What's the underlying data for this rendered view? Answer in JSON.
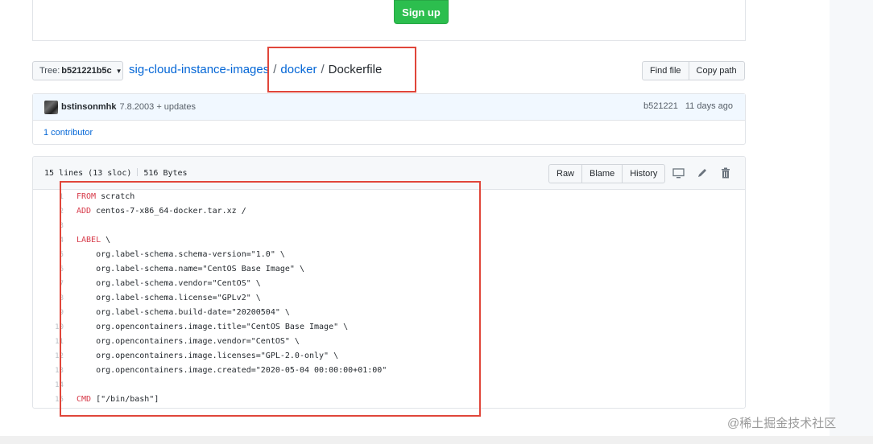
{
  "signup": {
    "label": "Sign up"
  },
  "tree": {
    "prefix": "Tree:",
    "value": "b521221b5c"
  },
  "breadcrumb": {
    "repo": "sig-cloud-instance-images",
    "folder": "docker",
    "file": "Dockerfile",
    "separator": "/"
  },
  "file_actions": {
    "find_file": "Find file",
    "copy_path": "Copy path"
  },
  "commit": {
    "author": "bstinsonmhk",
    "message": "7.8.2003 + updates",
    "sha": "b521221",
    "time": "11 days ago",
    "contributors": "1 contributor"
  },
  "file": {
    "lines_info": "15 lines (13 sloc)",
    "size": "516 Bytes",
    "buttons": {
      "raw": "Raw",
      "blame": "Blame",
      "history": "History"
    },
    "icons": [
      "desktop-icon",
      "pencil-icon",
      "trash-icon"
    ]
  },
  "code_lines": [
    {
      "num": "1",
      "kw": "FROM",
      "rest": " scratch"
    },
    {
      "num": "2",
      "kw": "ADD",
      "rest": " centos-7-x86_64-docker.tar.xz /"
    },
    {
      "num": "3",
      "kw": "",
      "rest": ""
    },
    {
      "num": "4",
      "kw": "LABEL",
      "rest": " \\"
    },
    {
      "num": "5",
      "kw": "",
      "rest": "    org.label-schema.schema-version=\"1.0\" \\"
    },
    {
      "num": "6",
      "kw": "",
      "rest": "    org.label-schema.name=\"CentOS Base Image\" \\"
    },
    {
      "num": "7",
      "kw": "",
      "rest": "    org.label-schema.vendor=\"CentOS\" \\"
    },
    {
      "num": "8",
      "kw": "",
      "rest": "    org.label-schema.license=\"GPLv2\" \\"
    },
    {
      "num": "9",
      "kw": "",
      "rest": "    org.label-schema.build-date=\"20200504\" \\"
    },
    {
      "num": "10",
      "kw": "",
      "rest": "    org.opencontainers.image.title=\"CentOS Base Image\" \\"
    },
    {
      "num": "11",
      "kw": "",
      "rest": "    org.opencontainers.image.vendor=\"CentOS\" \\"
    },
    {
      "num": "12",
      "kw": "",
      "rest": "    org.opencontainers.image.licenses=\"GPL-2.0-only\" \\"
    },
    {
      "num": "13",
      "kw": "",
      "rest": "    org.opencontainers.image.created=\"2020-05-04 00:00:00+01:00\""
    },
    {
      "num": "14",
      "kw": "",
      "rest": ""
    },
    {
      "num": "15",
      "kw": "CMD",
      "rest": " [\"/bin/bash\"]"
    }
  ],
  "colors": {
    "highlight": "#e0463a",
    "link": "#0366d6",
    "keyword": "#d73a49",
    "signup": "#2cbe4e"
  },
  "watermark": "@稀土掘金技术社区"
}
